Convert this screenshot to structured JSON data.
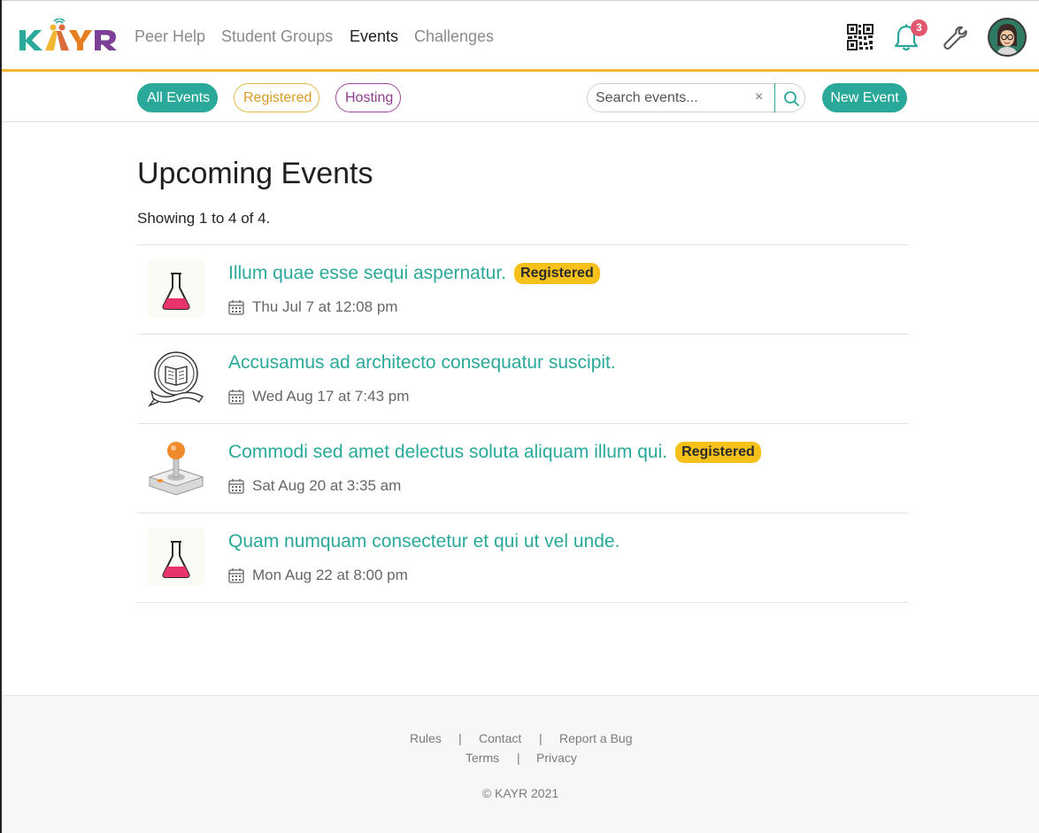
{
  "brand": {
    "logo_text": "KAYR",
    "colors": {
      "k": "#2aa99a",
      "a": "#f2b632",
      "y": "#e67e22",
      "r": "#7b3f98"
    }
  },
  "nav": {
    "links": [
      {
        "label": "Peer Help"
      },
      {
        "label": "Student Groups"
      },
      {
        "label": "Events",
        "active": true
      },
      {
        "label": "Challenges"
      }
    ],
    "notifications_count": "3",
    "icons": [
      "qr-code-icon",
      "bell-icon",
      "wrench-icon",
      "avatar"
    ]
  },
  "filters": {
    "all_label": "All Events",
    "registered_label": "Registered",
    "hosting_label": "Hosting",
    "search_placeholder": "Search events...",
    "search_value": "",
    "clear_glyph": "×",
    "new_event_label": "New Event"
  },
  "main": {
    "title": "Upcoming Events",
    "showing": "Showing 1 to 4 of 4."
  },
  "events": [
    {
      "title": "Illum quae esse sequi aspernatur.",
      "badge": "Registered",
      "date": "Thu Jul 7 at 12:08 pm",
      "icon": "flask-icon"
    },
    {
      "title": "Accusamus ad architecto consequatur suscipit.",
      "badge": "",
      "date": "Wed Aug 17 at 7:43 pm",
      "icon": "book-emblem-icon"
    },
    {
      "title": "Commodi sed amet delectus soluta aliquam illum qui.",
      "badge": "Registered",
      "date": "Sat Aug 20 at 3:35 am",
      "icon": "joystick-icon"
    },
    {
      "title": "Quam numquam consectetur et qui ut vel unde.",
      "badge": "",
      "date": "Mon Aug 22 at 8:00 pm",
      "icon": "flask-icon"
    }
  ],
  "footer": {
    "rules": "Rules",
    "contact": "Contact",
    "report_bug": "Report a Bug",
    "terms": "Terms",
    "privacy": "Privacy",
    "separator": "|",
    "copyright": "© KAYR 2021"
  },
  "colors": {
    "accent": "#2aa99a",
    "registered_badge": "#f5c11a",
    "nav_underline": "#f2b632",
    "hosting": "#8e3c8e"
  }
}
